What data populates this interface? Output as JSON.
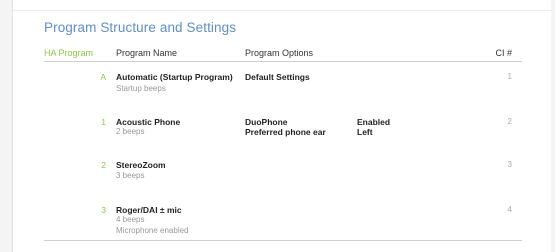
{
  "section_title": "Program Structure and Settings",
  "columns": {
    "ha_program": "HA Program",
    "program_name": "Program Name",
    "program_options": "Program Options",
    "ci_number": "CI #"
  },
  "rows": [
    {
      "ha": "A",
      "name": "Automatic (Startup Program)",
      "details": [
        "Startup beeps"
      ],
      "options": [
        {
          "label": "Default Settings",
          "value": ""
        }
      ],
      "ci": "1"
    },
    {
      "ha": "1",
      "name": "Acoustic Phone",
      "details": [
        "2 beeps"
      ],
      "options": [
        {
          "label": "DuoPhone",
          "value": "Enabled"
        },
        {
          "label": "Preferred phone ear",
          "value": "Left"
        }
      ],
      "ci": "2"
    },
    {
      "ha": "2",
      "name": "StereoZoom",
      "details": [
        "3 beeps"
      ],
      "options": [],
      "ci": "3"
    },
    {
      "ha": "3",
      "name": "Roger/DAI ± mic",
      "details": [
        "4 beeps",
        "Microphone enabled"
      ],
      "options": [],
      "ci": "4"
    }
  ],
  "colors": {
    "title": "#5b8fd0",
    "ha_accent": "#8cc63f",
    "text": "#222222",
    "muted": "#999999"
  }
}
